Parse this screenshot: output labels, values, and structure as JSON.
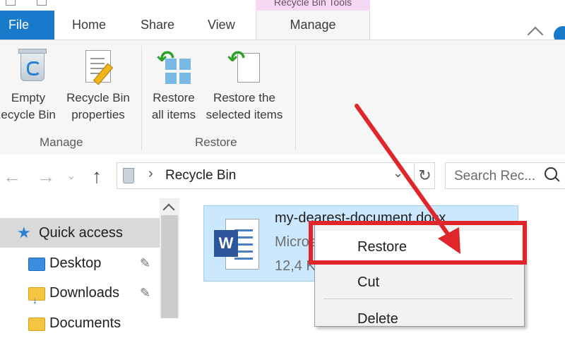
{
  "title_strip": {
    "context_label": "Recycle Bin Tools"
  },
  "tabs": [
    {
      "label": "File"
    },
    {
      "label": "Home"
    },
    {
      "label": "Share"
    },
    {
      "label": "View"
    },
    {
      "label": "Manage"
    }
  ],
  "ribbon": {
    "groups": [
      {
        "label": "Manage",
        "buttons": [
          {
            "line1": "Empty",
            "line2": "Recycle Bin",
            "icon": "recycle-bin-icon"
          },
          {
            "line1": "Recycle Bin",
            "line2": "properties",
            "icon": "properties-icon"
          }
        ]
      },
      {
        "label": "Restore",
        "buttons": [
          {
            "line1": "Restore",
            "line2": "all items",
            "icon": "restore-all-icon"
          },
          {
            "line1": "Restore the",
            "line2": "selected items",
            "icon": "restore-selected-icon"
          }
        ]
      }
    ]
  },
  "address_bar": {
    "path": "Recycle Bin",
    "search_placeholder": "Search Rec..."
  },
  "nav_pane": {
    "items": [
      {
        "label": "Quick access",
        "icon": "star-icon",
        "selected": true
      },
      {
        "label": "Desktop",
        "icon": "desktop-folder-icon",
        "pinned": true
      },
      {
        "label": "Downloads",
        "icon": "downloads-folder-icon",
        "pinned": true
      },
      {
        "label": "Documents",
        "icon": "documents-folder-icon"
      }
    ]
  },
  "file_item": {
    "name": "my-dearest-document.docx",
    "type": "Microsoft Word Document",
    "size": "12,4 KB",
    "icon": "word-document-icon"
  },
  "context_menu": {
    "items": [
      {
        "label": "Restore"
      },
      {
        "label": "Cut"
      },
      {
        "label": "Delete"
      }
    ]
  },
  "colors": {
    "file_tab": "#1979ca",
    "context_tab": "#f5d8f3",
    "selection": "#cce8ff",
    "annotation_red": "#e0262b"
  }
}
